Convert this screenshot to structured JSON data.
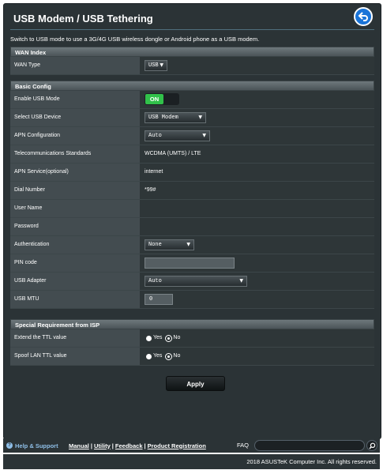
{
  "page": {
    "title": "USB Modem / USB Tethering",
    "description": "Switch to USB mode to use a 3G/4G USB wireless dongle or Android phone as a USB modem."
  },
  "wan_index": {
    "header": "WAN Index",
    "wan_type_label": "WAN Type",
    "wan_type_value": "USB"
  },
  "basic_config": {
    "header": "Basic Config",
    "enable_usb_mode_label": "Enable USB Mode",
    "enable_usb_mode_value": "ON",
    "select_usb_device_label": "Select USB Device",
    "select_usb_device_value": "USB Modem",
    "apn_configuration_label": "APN Configuration",
    "apn_configuration_value": "Auto",
    "telecom_standards_label": "Telecommunications Standards",
    "telecom_standards_value": "WCDMA (UMTS) / LTE",
    "apn_service_label": "APN Service(optional)",
    "apn_service_value": "internet",
    "dial_number_label": "Dial Number",
    "dial_number_value": "*99#",
    "user_name_label": "User Name",
    "user_name_value": "",
    "password_label": "Password",
    "password_value": "",
    "authentication_label": "Authentication",
    "authentication_value": "None",
    "pin_code_label": "PIN code",
    "pin_code_value": "",
    "usb_adapter_label": "USB Adapter",
    "usb_adapter_value": "Auto",
    "usb_mtu_label": "USB MTU",
    "usb_mtu_value": "0"
  },
  "special_isp": {
    "header": "Special Requirement from ISP",
    "extend_ttl_label": "Extend the TTL value",
    "spoof_ttl_label": "Spoof LAN TTL value",
    "yes_label": "Yes",
    "no_label": "No",
    "extend_ttl_selected": "No",
    "spoof_ttl_selected": "No"
  },
  "apply_label": "Apply",
  "footer": {
    "help_support": "Help & Support",
    "manual": "Manual",
    "utility": "Utility",
    "feedback": "Feedback",
    "product_registration": "Product Registration",
    "separator": "|",
    "faq_label": "FAQ",
    "copyright": "2018 ASUSTeK Computer Inc. All rights reserved."
  },
  "colors": {
    "panel_bg": "#2b3336",
    "toggle_on": "#31c14a",
    "back_button": "#1a74d8",
    "help_link": "#8fbfe8"
  },
  "icons": [
    "back-arrow-icon",
    "dropdown-arrow-icon",
    "help-icon",
    "search-icon"
  ]
}
